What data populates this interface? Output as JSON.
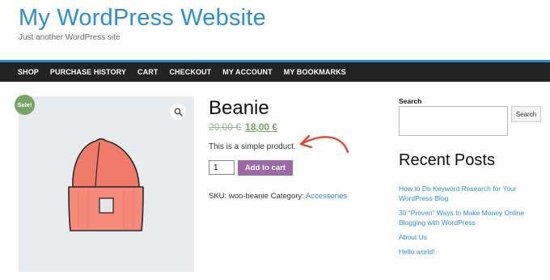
{
  "site": {
    "title": "My WordPress Website",
    "tagline": "Just another WordPress site"
  },
  "nav": {
    "items": [
      "SHOP",
      "PURCHASE HISTORY",
      "CART",
      "CHECKOUT",
      "MY ACCOUNT",
      "MY BOOKMARKS"
    ]
  },
  "product": {
    "sale_badge": "Sale!",
    "zoom_icon": "magnifier-icon",
    "title": "Beanie",
    "price_old": "20,00 €",
    "price_new": "18,00 €",
    "short_description": "This is a simple product.",
    "quantity": "1",
    "add_to_cart_label": "Add to cart",
    "sku_label": "SKU:",
    "sku_value": "woo-beanie",
    "category_label": "Category:",
    "category_link": "Accessories",
    "image_icon": "beanie-illustration",
    "colors": {
      "beanie": "#f07b6b",
      "sale_badge": "#77a464",
      "button": "#9b6aa6",
      "arrow": "#e8452c"
    }
  },
  "sidebar": {
    "search_label": "Search",
    "search_value": "",
    "search_button": "Search",
    "recent_posts_title": "Recent Posts",
    "recent_posts": [
      "How to Do Keyword Research for Your WordPress Blog",
      "30 “Proven” Ways to Make Money Online Blogging with WordPress",
      "About Us",
      "Hello world!"
    ]
  }
}
